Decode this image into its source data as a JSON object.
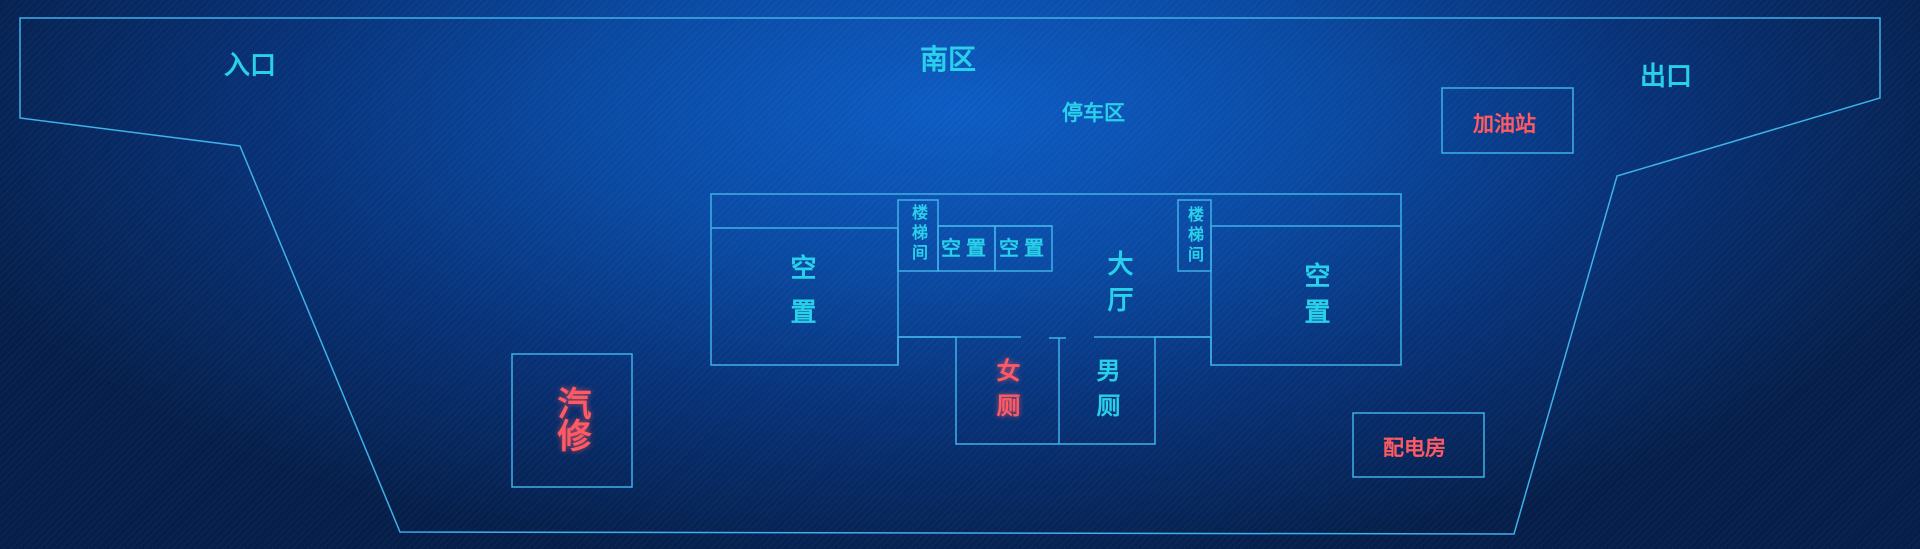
{
  "map": {
    "entrance": "入口",
    "exit": "出口",
    "south_zone": "南区",
    "parking": "停车区",
    "gas_station": "加油站",
    "auto_repair": "汽修",
    "power_room": "配电房",
    "hall": "大厅",
    "vacant_left": "空置",
    "vacant_right": "空置",
    "vacant_small_1": "空置",
    "vacant_small_2": "空置",
    "stairs_left": "楼梯间",
    "stairs_right": "楼梯间",
    "womens_restroom": "女厕",
    "mens_restroom": "男厕"
  },
  "colors": {
    "background_center": "#0d5cc4",
    "background_edge": "#061f4a",
    "outline": "#3fb0e8",
    "label_primary": "#29d0ea",
    "label_alert": "#ff5a63"
  }
}
